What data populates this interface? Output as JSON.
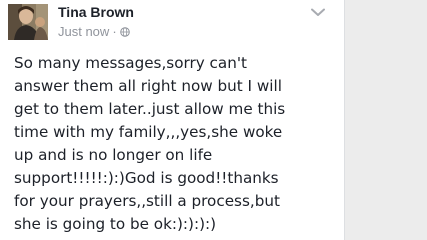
{
  "post": {
    "author": "Tina Brown",
    "timestamp": "Just now",
    "separator": "·",
    "privacy_icon": "globe-icon",
    "options_icon": "chevron-down-icon",
    "avatar_icon": "profile-photo",
    "text_lines": [
      "So many messages,sorry can't",
      "answer them all right now but I will",
      "get to them later..just allow me this",
      "time with my family,,,yes,she woke",
      "up and is no longer on life",
      "support!!!!!:):)God is good!!thanks",
      "for your prayers,,still a process,but",
      "she is going to be ok:):):):)"
    ]
  },
  "colors": {
    "author": "#1d2129",
    "meta": "#90949c",
    "text": "#1d2129",
    "background": "#ececec",
    "card": "#ffffff"
  }
}
